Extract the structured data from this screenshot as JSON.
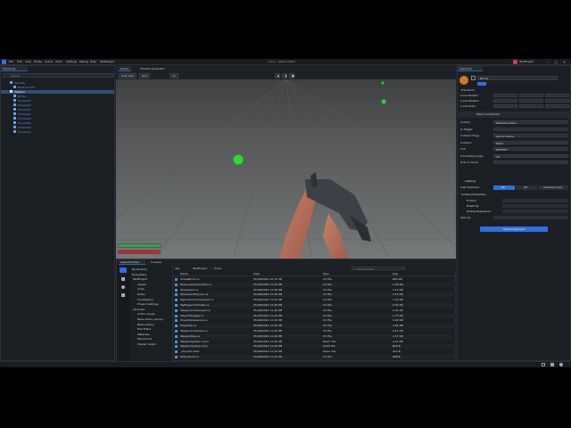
{
  "menu": {
    "items": [
      "File",
      "Edit",
      "View",
      "Nodes",
      "Scene",
      "Tools",
      "Settings",
      "Debug",
      "Help",
      "TestProject"
    ],
    "title": "scene - s&box editor",
    "project": "TestProject"
  },
  "hierarchy": {
    "tab": "Hierarchy",
    "search_placeholder": "Search",
    "rows": [
      {
        "label": "Camera",
        "indent": 2,
        "selected": false
      },
      {
        "label": "Environment",
        "indent": 3,
        "selected": false
      },
      {
        "label": "Weapon",
        "indent": 2,
        "selected": true
      },
      {
        "label": "Bricks",
        "indent": 3,
        "selected": false
      },
      {
        "label": "Unnamed",
        "indent": 3,
        "selected": false
      },
      {
        "label": "Unnamed",
        "indent": 3,
        "selected": false
      },
      {
        "label": "Unnamed",
        "indent": 3,
        "selected": false
      },
      {
        "label": "Unnamed",
        "indent": 3,
        "selected": false
      },
      {
        "label": "Unnamed",
        "indent": 3,
        "selected": false
      },
      {
        "label": "Unnamed",
        "indent": 3,
        "selected": false
      },
      {
        "label": "Unnamed",
        "indent": 3,
        "selected": false
      },
      {
        "label": "Unnamed",
        "indent": 3,
        "selected": false
      }
    ]
  },
  "viewport": {
    "tabs": [
      "Scene",
      "Preview Generator"
    ],
    "tools": [
      "Free Cam",
      "Grid",
      "Lit",
      "Play",
      "Pause",
      "Stop"
    ]
  },
  "hud": {
    "health_fraction": 1.0,
    "armor_fraction": 1.0,
    "health_color": "#2fa84f",
    "armor_color": "#c0262c"
  },
  "assets": {
    "tabs": [
      "Asset Browser",
      "Console"
    ],
    "breadcrumb": [
      "TestProject",
      "Code"
    ],
    "search_placeholder": "Search Code",
    "tree": [
      "Bookmarks",
      "Everything",
      "TestProject",
      "Assets",
      "Code",
      "Editor",
      "Localization",
      "Project Settings",
      "Libraries",
      "Action Graph",
      "Base Addon Library",
      "Base Library",
      "Fish Editor",
      "Materials",
      "Movement",
      "Shader Graph"
    ],
    "columns": [
      "Name",
      "Date",
      "Type",
      "Size"
    ],
    "files": [
      {
        "name": "ChaseBlock.cs",
        "date": "05/28/2024 12:35 AM",
        "type": "CS File",
        "size": "683 KB"
      },
      {
        "name": "DistanceComponent.cs",
        "date": "05/28/2024 11:40 PM",
        "type": "CS File",
        "size": "4.49 KB"
      },
      {
        "name": "Movement.cs",
        "date": "05/28/2024 11:40 PM",
        "type": "CS File",
        "size": "3.12 KB"
      },
      {
        "name": "MovementPhysics.cs",
        "date": "05/28/2024 11:40 PM",
        "type": "CS File",
        "size": "1.53 KB"
      },
      {
        "name": "MyCustomComponent.cs",
        "date": "05/28/2024 11:40 PM",
        "type": "CS File",
        "size": "1.02 KB"
      },
      {
        "name": "MyPlayerController.cs",
        "date": "05/28/2024 11:40 PM",
        "type": "CS File",
        "size": "2.93 KB"
      },
      {
        "name": "WeaponComponent.cs",
        "date": "05/28/2024 11:40 PM",
        "type": "CS File",
        "size": "2.41 KB"
      },
      {
        "name": "PlayerManager.cs",
        "date": "05/28/2024 11:40 PM",
        "type": "CS File",
        "size": "1.74 KB"
      },
      {
        "name": "ProjectileSpawner.cs",
        "date": "05/28/2024 11:40 PM",
        "type": "CS File",
        "size": "3.08 KB"
      },
      {
        "name": "Projectile.cs",
        "date": "05/28/2024 11:40 PM",
        "type": "CS File",
        "size": "1.81 KB"
      },
      {
        "name": "WeaponController.cs",
        "date": "05/28/2024 11:40 PM",
        "type": "CS File",
        "size": "4.11 KB"
      },
      {
        "name": "WeaponBag.cs",
        "date": "05/28/2024 11:40 PM",
        "type": "CS File",
        "size": "1.27 KB"
      },
      {
        "name": "WeaponSystem.razor",
        "date": "05/28/2024 11:40 PM",
        "type": "Razor File",
        "size": "2.02 KB"
      },
      {
        "name": "WeaponSystem.scss",
        "date": "05/28/2024 11:40 PM",
        "type": "SCSS File",
        "size": "818 B"
      },
      {
        "name": "_Imports.razor",
        "date": "05/28/2024 11:40 PM",
        "type": "Razor File",
        "size": "412 B"
      },
      {
        "name": "EditorHook.cs",
        "date": "05/28/2024 11:40 PM",
        "type": "CS File",
        "size": "988 B"
      }
    ]
  },
  "inspector": {
    "tab": "Inspector",
    "object_name": "Bricks",
    "transform_title": "Transform",
    "position_label": "Local Position",
    "rotation_label": "Local Rotation",
    "scale_label": "Local Scale",
    "component_title": "Mesh Component",
    "fields": [
      {
        "label": "Surface",
        "value": "Default surface"
      },
      {
        "label": "Is Trigger",
        "value": ""
      },
      {
        "label": "Collision Flags",
        "value": "Ignore Traces"
      },
      {
        "label": "Collision",
        "value": "Mesh"
      },
      {
        "label": "Tint",
        "value": "#FFFFFF"
      },
      {
        "label": "Smoothing Angle",
        "value": "40"
      },
      {
        "label": "Hide In Game",
        "value": ""
      }
    ],
    "lighting_title": "Lighting",
    "cast_shadows_label": "Cast Shadows",
    "cast_shadows_options": [
      "On",
      "Off",
      "Shadows Only"
    ],
    "surface_props_title": "Surface Properties",
    "surface_props": [
      "Friction",
      "Elasticity",
      "Rolling Resistance"
    ],
    "velocity_label": "Velocity",
    "add_component": "Add Component"
  },
  "status": {
    "left": "",
    "right": ""
  }
}
